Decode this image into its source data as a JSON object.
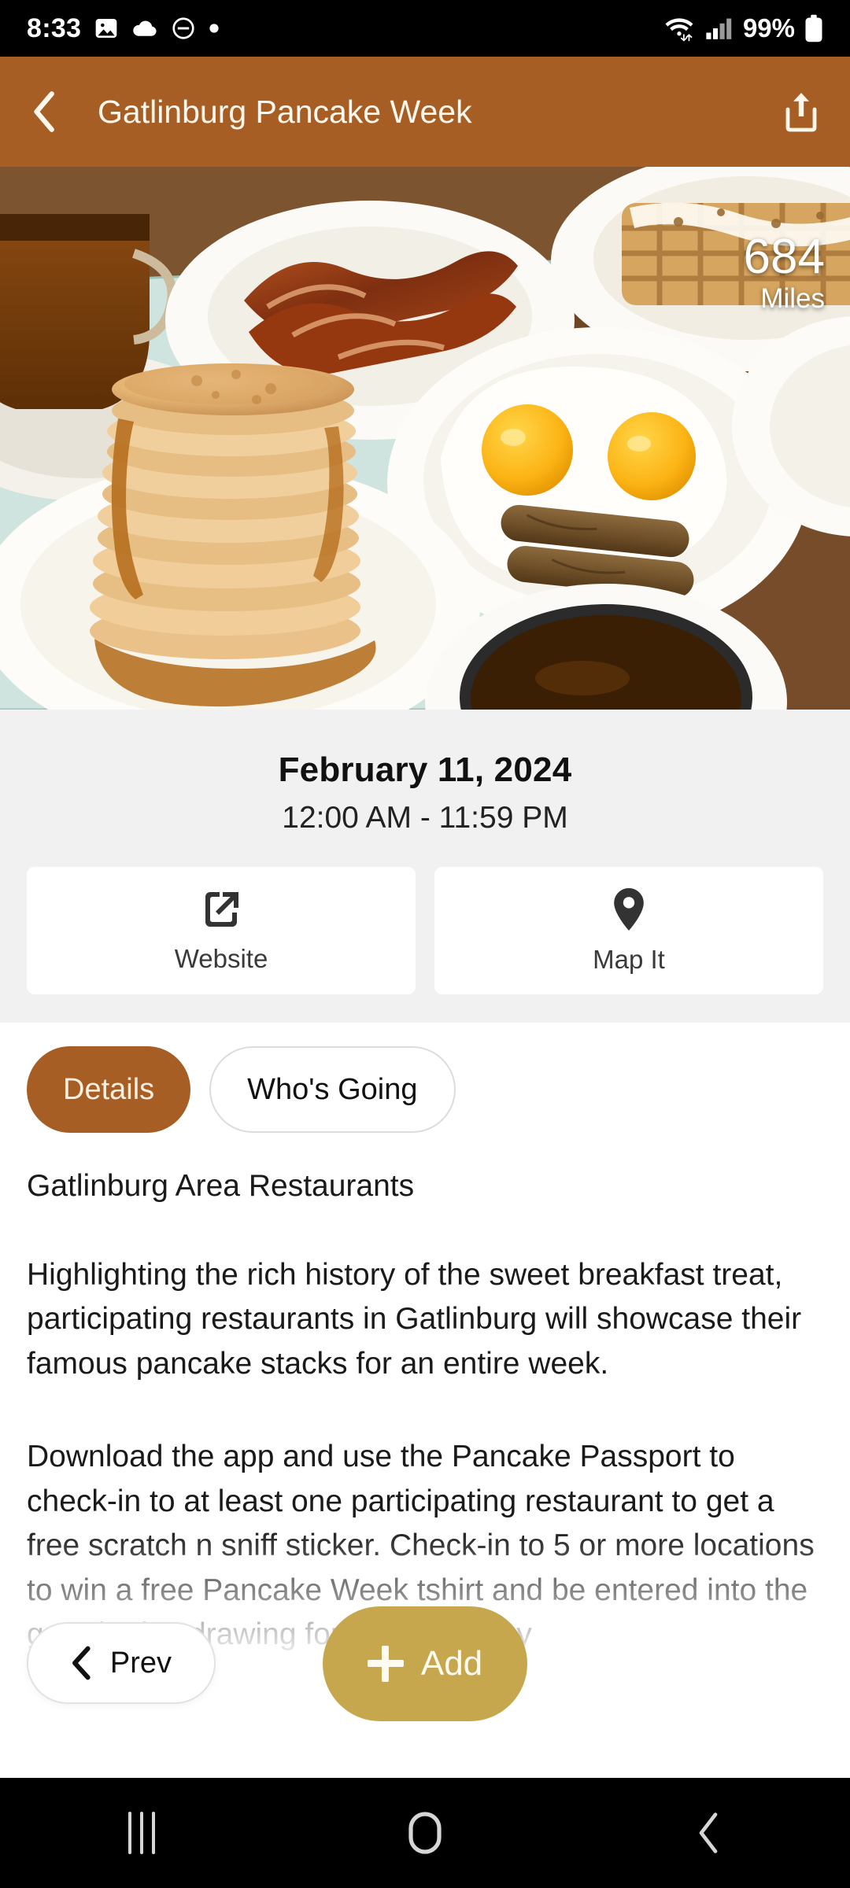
{
  "status_bar": {
    "time": "8:33",
    "battery_percent": "99%",
    "icons": [
      "photo-icon",
      "cloud-icon",
      "do-not-disturb-icon",
      "dot-icon",
      "wifi-icon",
      "cellular-signal-icon",
      "battery-icon"
    ]
  },
  "app_bar": {
    "back_icon": "chevron-left-icon",
    "title": "Gatlinburg Pancake Week",
    "share_icon": "share-icon"
  },
  "hero": {
    "distance_value": "684",
    "distance_unit": "Miles",
    "alt": "breakfast table with tall pancake stack, fried eggs, sausage links, bacon, syrup pitcher and waffles"
  },
  "event": {
    "date": "February 11, 2024",
    "time_range": "12:00 AM - 11:59 PM"
  },
  "actions": [
    {
      "label": "Website",
      "icon": "external-link-icon"
    },
    {
      "label": "Map It",
      "icon": "map-pin-icon"
    }
  ],
  "tabs": [
    {
      "label": "Details",
      "active": true
    },
    {
      "label": "Who's Going",
      "active": false
    }
  ],
  "details": {
    "venue": "Gatlinburg Area Restaurants",
    "paragraph_1": "Highlighting the rich history of the sweet breakfast treat, participating restaurants in Gatlinburg will showcase their famous pancake stacks for an entire week.",
    "paragraph_2": "Download the app and use the Pancake Passport to check-in to at least one participating restaurant to get a free scratch n sniff sticker. Check-in to 5 or more locations to win a free Pancake Week tshirt and be entered into the grand prize drawing for a 2 night stay"
  },
  "floating": {
    "prev_label": "Prev",
    "prev_icon": "chevron-left-icon",
    "add_label": "Add",
    "add_icon": "plus-icon"
  },
  "nav_bar": {
    "recents_icon": "recents-icon",
    "home_icon": "home-icon",
    "back_icon": "back-icon"
  },
  "colors": {
    "brand_brown": "#A65E24",
    "add_gold": "#C6A74E",
    "panel_grey": "#F1F1F1",
    "status_bar": "#000000"
  }
}
